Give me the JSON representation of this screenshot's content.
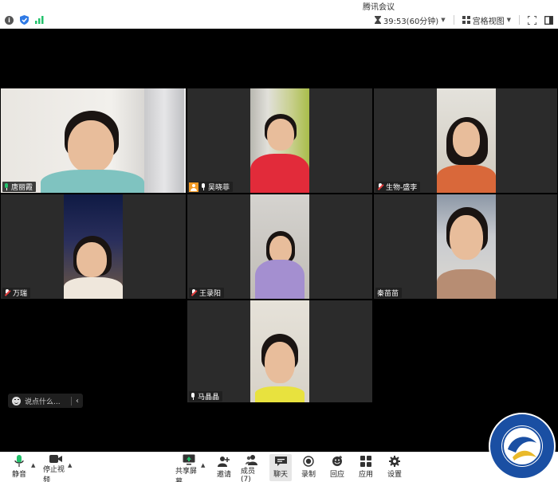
{
  "window": {
    "title": "腾讯会议"
  },
  "status": {
    "timer": "39:53(60分钟)",
    "view_mode": "宫格视图"
  },
  "participants": [
    {
      "name": "唐丽霞"
    },
    {
      "name": "吴晓菲"
    },
    {
      "name": "生物-盛李"
    },
    {
      "name": "万瑞"
    },
    {
      "name": "王录阳"
    },
    {
      "name": "秦苗苗"
    },
    {
      "name": "马晶晶"
    }
  ],
  "chat": {
    "placeholder": "说点什么..."
  },
  "toolbar": {
    "mute": "静音",
    "stop_video": "停止视频",
    "share_screen": "共享屏幕",
    "invite": "邀请",
    "members": "成员(7)",
    "chat": "聊天",
    "record": "录制",
    "playback": "回应",
    "apps": "应用",
    "settings": "设置"
  },
  "colors": {
    "accent_green": "#22c16b",
    "stage_bg": "#000000",
    "tile_bg": "#2b2b2b"
  }
}
